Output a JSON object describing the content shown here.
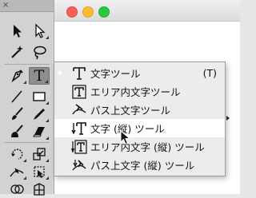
{
  "window": {
    "controls": [
      "close",
      "minimize",
      "zoom"
    ]
  },
  "tools_panel": {
    "close_glyph": "×",
    "tools": [
      {
        "icon": "selection-arrow-icon"
      },
      {
        "icon": "direct-selection-arrow-icon"
      },
      {
        "icon": "magic-wand-icon"
      },
      {
        "icon": "lasso-icon"
      },
      {
        "icon": "pen-icon"
      },
      {
        "icon": "type-icon",
        "letter": "T",
        "active": true
      },
      {
        "icon": "line-icon"
      },
      {
        "icon": "rectangle-icon"
      },
      {
        "icon": "paintbrush-icon"
      },
      {
        "icon": "pencil-icon"
      },
      {
        "icon": "blob-brush-icon"
      },
      {
        "icon": "eraser-icon"
      },
      {
        "icon": "rotate-icon"
      },
      {
        "icon": "scale-icon"
      },
      {
        "icon": "width-icon"
      },
      {
        "icon": "free-transform-icon"
      },
      {
        "icon": "shape-builder-icon"
      },
      {
        "icon": "perspective-grid-icon"
      }
    ]
  },
  "type_tool_flyout": {
    "items": [
      {
        "icon": "type-tool-icon",
        "label": "文字ツール",
        "shortcut": "(T)",
        "selected": true
      },
      {
        "icon": "area-type-tool-icon",
        "label": "エリア内文字ツール"
      },
      {
        "icon": "type-on-path-tool-icon",
        "label": "パス上文字ツール"
      },
      {
        "icon": "vertical-type-tool-icon",
        "label": "文字 (縦) ツール",
        "hovered": true
      },
      {
        "icon": "vertical-area-type-tool-icon",
        "label": "エリア内文字 (縦) ツール"
      },
      {
        "icon": "vertical-type-on-path-tool-icon",
        "label": "パス上文字 (縦) ツール"
      }
    ]
  },
  "colors": {
    "hover": "#ffffff",
    "menu_bg": "#ececec",
    "panel_bg": "#d2d2d2"
  }
}
